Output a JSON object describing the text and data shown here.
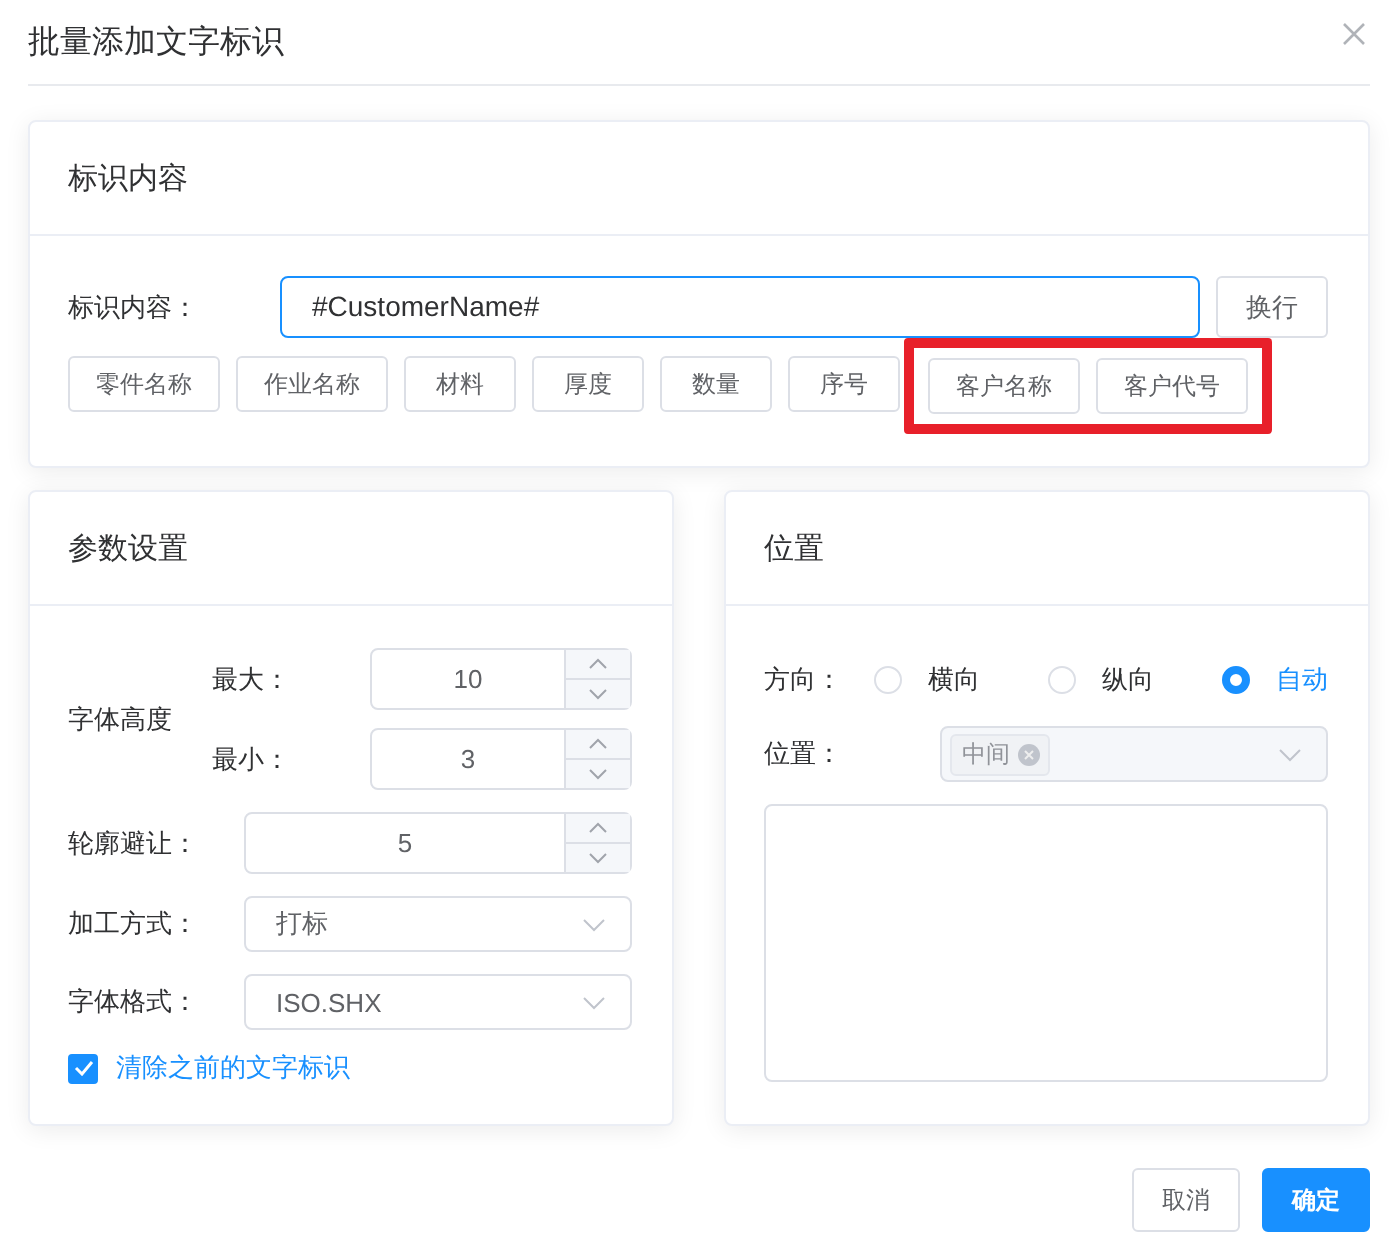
{
  "dialog": {
    "title": "批量添加文字标识"
  },
  "content_card": {
    "title": "标识内容",
    "label": "标识内容：",
    "value": "#CustomerName#",
    "newline_button": "换行",
    "tokens": [
      {
        "label": "零件名称",
        "highlighted": false
      },
      {
        "label": "作业名称",
        "highlighted": false
      },
      {
        "label": "材料",
        "highlighted": false
      },
      {
        "label": "厚度",
        "highlighted": false
      },
      {
        "label": "数量",
        "highlighted": false
      },
      {
        "label": "序号",
        "highlighted": false
      },
      {
        "label": "客户名称",
        "highlighted": true
      },
      {
        "label": "客户代号",
        "highlighted": true
      }
    ]
  },
  "params_card": {
    "title": "参数设置",
    "font_height": {
      "label": "字体高度",
      "max": {
        "label": "最大：",
        "value": "10"
      },
      "min": {
        "label": "最小：",
        "value": "3"
      }
    },
    "avoid": {
      "label": "轮廓避让：",
      "value": "5"
    },
    "selects": [
      {
        "label": "加工方式：",
        "value": "打标"
      },
      {
        "label": "字体格式：",
        "value": "ISO.SHX"
      }
    ],
    "clear": {
      "label": "清除之前的文字标识",
      "checked": true
    }
  },
  "position_card": {
    "title": "位置",
    "direction": {
      "label": "方向：",
      "options": [
        {
          "label": "横向",
          "selected": false
        },
        {
          "label": "纵向",
          "selected": false
        },
        {
          "label": "自动",
          "selected": true
        }
      ]
    },
    "position": {
      "label": "位置：",
      "tags": [
        "中间"
      ]
    }
  },
  "buttons": [
    {
      "label": "取消",
      "kind": "default"
    },
    {
      "label": "确定",
      "kind": "primary"
    }
  ]
}
